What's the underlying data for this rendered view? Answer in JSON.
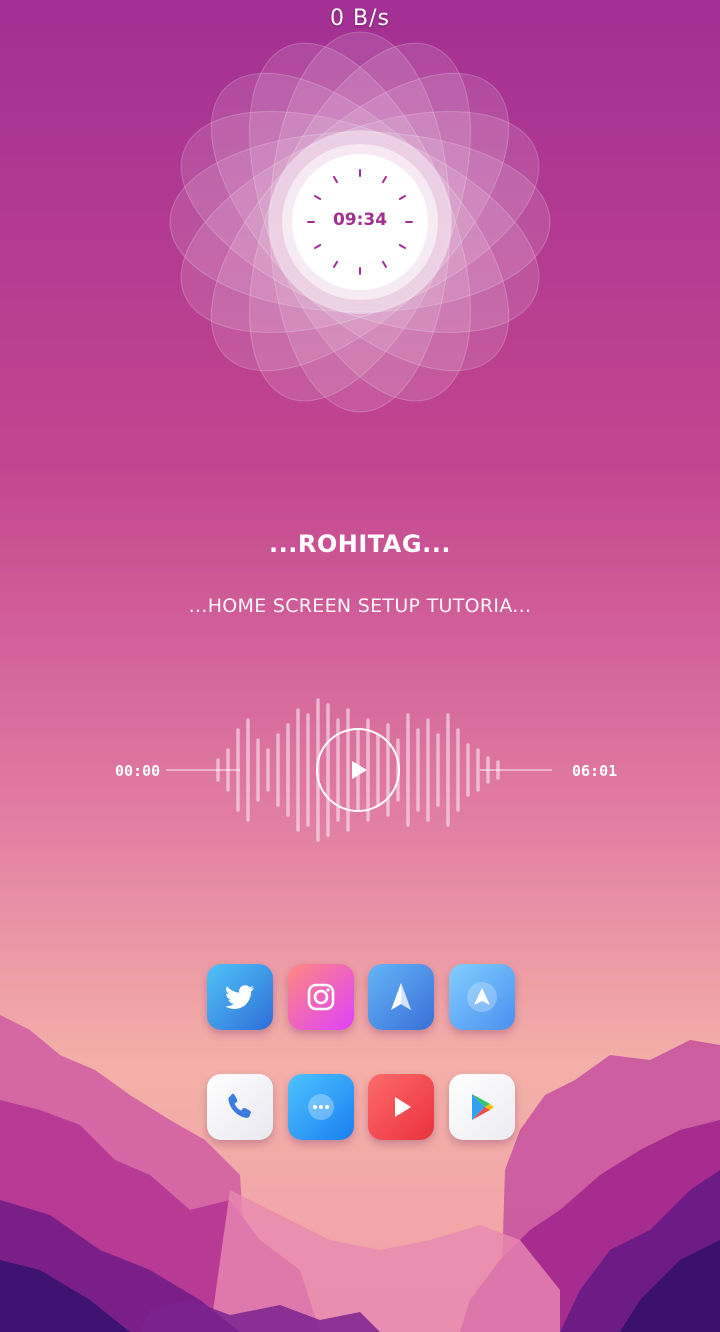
{
  "status": {
    "net_speed": "0 B/s"
  },
  "clock_widget": {
    "time": "09:34"
  },
  "music_widget": {
    "title": "...ROHITAG...",
    "subtitle": "...HOME SCREEN SETUP TUTORIA...",
    "elapsed": "00:00",
    "duration": "06:01",
    "progress": 0
  },
  "dock": {
    "row1": [
      {
        "name": "twitter",
        "icon": "twitter-bird-icon"
      },
      {
        "name": "instagram",
        "icon": "instagram-camera-icon"
      },
      {
        "name": "navigation",
        "icon": "paper-plane-icon"
      },
      {
        "name": "navigation-2",
        "icon": "navigation-arrow-icon"
      }
    ],
    "row2": [
      {
        "name": "phone",
        "icon": "phone-icon"
      },
      {
        "name": "messages",
        "icon": "chat-bubble-icon"
      },
      {
        "name": "youtube",
        "icon": "play-icon"
      },
      {
        "name": "play-store",
        "icon": "play-store-icon"
      }
    ]
  },
  "colors": {
    "accent": "#a12f8f",
    "sky_top": "#a22f94",
    "sky_bottom": "#f4b0a8"
  }
}
